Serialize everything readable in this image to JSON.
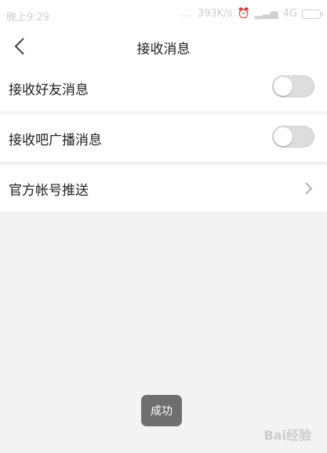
{
  "status_bar": {
    "time": "晚上9:29",
    "dots": "...",
    "speed": "393K/s",
    "signal": "4G"
  },
  "header": {
    "title": "接收消息"
  },
  "settings": [
    {
      "label": "接收好友消息",
      "enabled": false
    },
    {
      "label": "接收吧广播消息",
      "enabled": false
    },
    {
      "label": "官方帐号推送"
    }
  ],
  "toast": {
    "text": "成功"
  },
  "watermark": {
    "text": "Bai经验"
  },
  "colors": {
    "background": "#f3f3f3",
    "row_background": "#ffffff",
    "toggle_off": "#dddddd",
    "toast": "#6f6f6f"
  }
}
